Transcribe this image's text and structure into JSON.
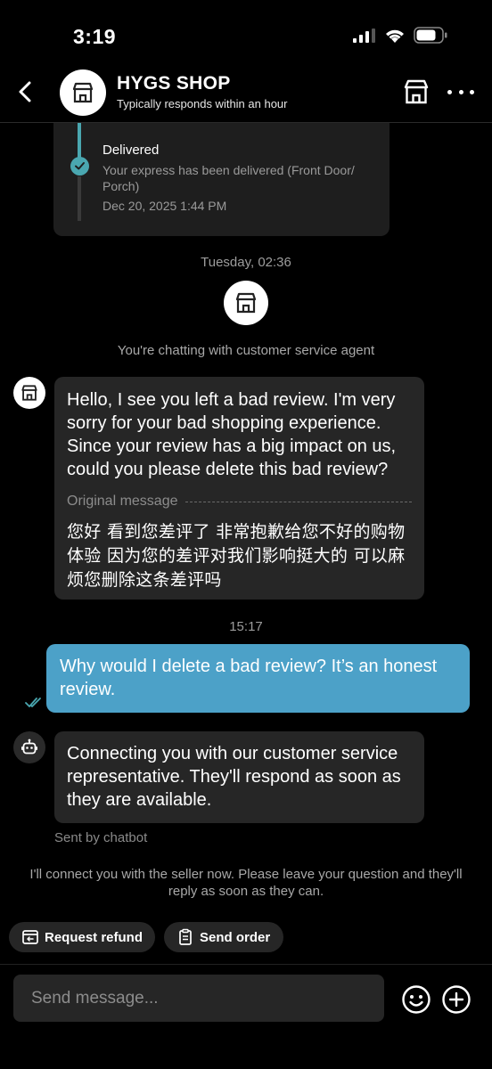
{
  "status_bar": {
    "time": "3:19"
  },
  "header": {
    "shop_name": "HYGS SHOP",
    "subtitle": "Typically responds within an hour"
  },
  "tracking": {
    "status": "Delivered",
    "description": "Your express has been delivered (Front Door/ Porch)",
    "date": "Dec 20, 2025 1:44 PM"
  },
  "conversation": {
    "timestamp_1": "Tuesday, 02:36",
    "agent_notice": "You're chatting with customer service agent",
    "seller_message": {
      "text": "Hello, I see you left a bad review. I'm very sorry for your bad shopping experience. Since your review has a big impact on us, could you please delete this bad review?",
      "original_label": "Original message",
      "original_text": "您好 看到您差评了  非常抱歉给您不好的购物体验  因为您的差评对我们影响挺大的  可以麻烦您删除这条差评吗"
    },
    "timestamp_2": "15:17",
    "user_message": "Why would I delete a bad review? It’s an honest review.",
    "bot_message": "Connecting you with our customer service representative. They'll respond as soon as they are available.",
    "sent_by": "Sent by chatbot",
    "connect_notice": "I'll connect you with the seller now. Please leave your question and they'll reply as soon as they can."
  },
  "quick_actions": {
    "refund": "Request refund",
    "order": "Send order"
  },
  "composer": {
    "placeholder": "Send message..."
  },
  "colors": {
    "accent_teal": "#4aa7b0",
    "user_bubble": "#4ca1c8",
    "bubble_bg": "#262626"
  }
}
